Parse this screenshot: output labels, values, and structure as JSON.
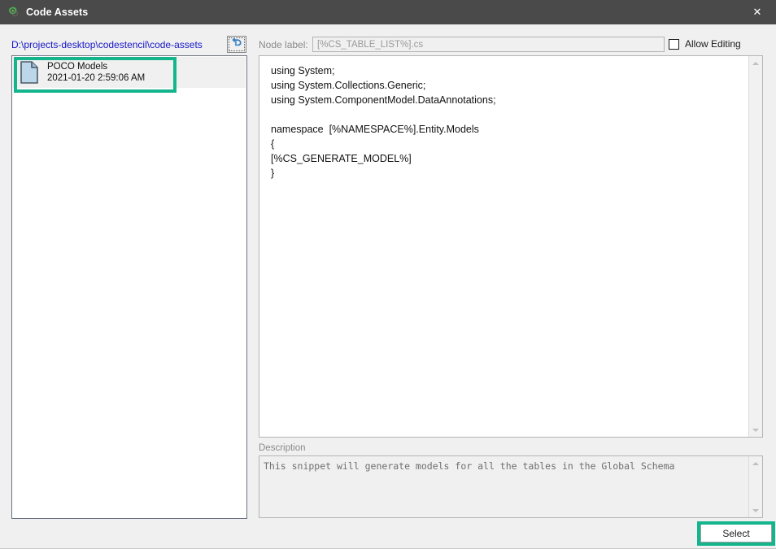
{
  "window": {
    "title": "Code Assets",
    "icon": "gear-icon",
    "close_label": "✕",
    "titlebar_color": "#4a4a4a",
    "accent_highlight_color": "#14b58c",
    "link_color": "#1818c8"
  },
  "left_panel": {
    "path": "D:\\projects-desktop\\codestencil\\code-assets",
    "back_button": {
      "name": "back-button",
      "icon": "undo-arrow-icon"
    },
    "list_items": [
      {
        "icon": "file-document-icon",
        "title": "POCO Models",
        "subtitle": "2021-01-20 2:59:06 AM",
        "selected": true
      }
    ]
  },
  "right_panel": {
    "node_label": {
      "label": "Node label:",
      "value": "[%CS_TABLE_LIST%].cs",
      "placeholder": "[%CS_TABLE_LIST%].cs"
    },
    "allow_editing": {
      "label": "Allow Editing",
      "checked": false
    },
    "code": "using System;\nusing System.Collections.Generic;\nusing System.ComponentModel.DataAnnotations;\n\nnamespace  [%NAMESPACE%].Entity.Models\n{\n[%CS_GENERATE_MODEL%]\n}",
    "description": {
      "label": "Description",
      "text": "This snippet will generate models for all the tables in the Global Schema"
    },
    "select_button": {
      "label": "Select",
      "highlighted": true
    }
  }
}
